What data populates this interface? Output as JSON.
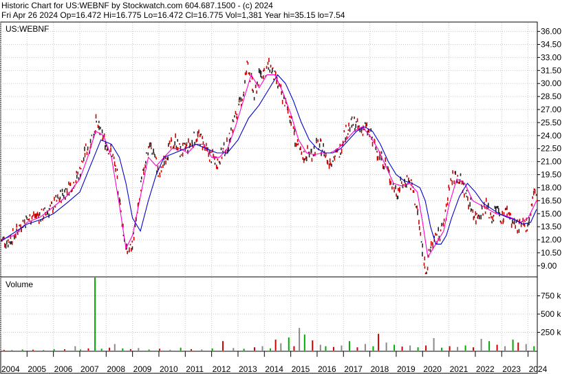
{
  "header": {
    "line1": "Historic Chart for US:WEBNF by Stockwatch.com 604.687.1500 - (c) 2024",
    "line2": "Fri Apr 26 2024   Op=16.472   Hi=16.775   Lo=16.472   Cl=16.775   Vol=1,381   Year hi=35.15   lo=7.54"
  },
  "chart_data": [
    {
      "type": "line",
      "title": "US:WEBNF",
      "ylim": [
        7.8,
        37.0
      ],
      "y_ticks": [
        "36.00",
        "34.50",
        "33.00",
        "31.50",
        "30.00",
        "28.50",
        "27.00",
        "25.50",
        "24.00",
        "22.50",
        "21.00",
        "19.50",
        "18.00",
        "16.50",
        "15.00",
        "13.50",
        "12.00",
        "10.50",
        "9.00"
      ],
      "x_ticks": [
        "2004",
        "2005",
        "2006",
        "2007",
        "2008",
        "2009",
        "2010",
        "2011",
        "2012",
        "2013",
        "2014",
        "2015",
        "2016",
        "2017",
        "2018",
        "2019",
        "2020",
        "2021",
        "2022",
        "2023",
        "2024"
      ],
      "xlim": [
        2004.0,
        2024.35
      ],
      "colors": {
        "price": "#cc0000",
        "dark": "#222222",
        "fast_ma": "#ff00cc",
        "slow_ma": "#0000cc",
        "grid": "#c8c8c8"
      },
      "series": [
        {
          "role": "price",
          "x": [
            2004.0,
            2004.25,
            2004.5,
            2004.75,
            2005.0,
            2005.25,
            2005.5,
            2005.75,
            2006.0,
            2006.25,
            2006.5,
            2006.75,
            2007.0,
            2007.2,
            2007.4,
            2007.6,
            2007.8,
            2008.0,
            2008.2,
            2008.4,
            2008.6,
            2008.75,
            2008.9,
            2009.0,
            2009.2,
            2009.4,
            2009.6,
            2009.8,
            2010.0,
            2010.2,
            2010.4,
            2010.6,
            2010.8,
            2011.0,
            2011.2,
            2011.4,
            2011.6,
            2011.8,
            2012.0,
            2012.2,
            2012.4,
            2012.6,
            2012.8,
            2013.0,
            2013.2,
            2013.35,
            2013.5,
            2013.6,
            2013.8,
            2014.0,
            2014.2,
            2014.4,
            2014.6,
            2014.8,
            2015.0,
            2015.2,
            2015.4,
            2015.6,
            2015.8,
            2016.0,
            2016.2,
            2016.4,
            2016.6,
            2016.8,
            2017.0,
            2017.2,
            2017.4,
            2017.6,
            2017.8,
            2018.0,
            2018.2,
            2018.4,
            2018.6,
            2018.8,
            2019.0,
            2019.2,
            2019.4,
            2019.6,
            2019.8,
            2020.0,
            2020.15,
            2020.3,
            2020.5,
            2020.7,
            2020.9,
            2021.0,
            2021.2,
            2021.4,
            2021.6,
            2021.8,
            2022.0,
            2022.2,
            2022.4,
            2022.6,
            2022.8,
            2023.0,
            2023.2,
            2023.4,
            2023.6,
            2023.8,
            2024.0,
            2024.2,
            2024.32
          ],
          "values": [
            12.0,
            11.8,
            12.6,
            13.8,
            14.3,
            14.8,
            14.7,
            15.2,
            16.0,
            17.0,
            17.8,
            18.6,
            20.0,
            22.3,
            23.2,
            25.5,
            24.0,
            23.0,
            22.0,
            19.0,
            14.0,
            10.5,
            11.0,
            12.0,
            15.5,
            20.0,
            23.0,
            22.0,
            19.0,
            21.5,
            22.5,
            23.5,
            22.0,
            22.5,
            23.0,
            24.0,
            23.5,
            22.0,
            21.5,
            21.0,
            22.0,
            23.0,
            25.5,
            27.0,
            29.0,
            32.5,
            30.0,
            28.5,
            31.0,
            31.5,
            32.0,
            30.5,
            29.0,
            27.5,
            26.0,
            23.0,
            21.5,
            22.0,
            22.0,
            23.0,
            22.5,
            21.0,
            21.5,
            22.0,
            24.0,
            25.0,
            25.5,
            24.5,
            25.0,
            24.0,
            22.5,
            21.5,
            20.5,
            18.5,
            17.5,
            18.5,
            19.0,
            18.0,
            15.0,
            10.0,
            8.5,
            11.5,
            12.0,
            13.0,
            15.5,
            18.5,
            19.5,
            19.0,
            17.5,
            16.0,
            14.5,
            15.5,
            16.0,
            14.5,
            15.5,
            14.5,
            15.5,
            14.0,
            13.5,
            13.5,
            14.0,
            17.5,
            16.8
          ]
        },
        {
          "role": "fast_ma",
          "x": [
            2004.0,
            2004.5,
            2005.0,
            2005.5,
            2006.0,
            2006.5,
            2007.0,
            2007.3,
            2007.6,
            2007.9,
            2008.2,
            2008.5,
            2008.75,
            2009.0,
            2009.3,
            2009.6,
            2009.9,
            2010.2,
            2010.5,
            2010.8,
            2011.1,
            2011.4,
            2011.7,
            2012.0,
            2012.3,
            2012.6,
            2012.9,
            2013.2,
            2013.5,
            2013.8,
            2014.1,
            2014.4,
            2014.7,
            2015.0,
            2015.3,
            2015.6,
            2015.9,
            2016.2,
            2016.5,
            2016.8,
            2017.1,
            2017.4,
            2017.7,
            2018.0,
            2018.3,
            2018.6,
            2018.9,
            2019.2,
            2019.5,
            2019.8,
            2020.0,
            2020.2,
            2020.4,
            2020.6,
            2020.8,
            2021.0,
            2021.3,
            2021.6,
            2021.9,
            2022.2,
            2022.5,
            2022.8,
            2023.1,
            2023.4,
            2023.7,
            2024.0,
            2024.32
          ],
          "values": [
            12.0,
            12.5,
            14.0,
            14.6,
            15.8,
            17.0,
            19.0,
            21.5,
            24.5,
            24.0,
            21.5,
            16.0,
            11.0,
            12.5,
            17.0,
            21.5,
            20.5,
            21.5,
            22.5,
            22.5,
            22.0,
            23.0,
            23.0,
            21.5,
            21.5,
            22.5,
            25.0,
            28.0,
            31.0,
            29.5,
            31.0,
            31.0,
            29.0,
            26.5,
            23.5,
            22.0,
            21.8,
            22.0,
            22.0,
            22.5,
            23.5,
            24.5,
            25.0,
            24.0,
            22.5,
            20.5,
            18.5,
            18.2,
            18.5,
            17.5,
            14.0,
            10.0,
            11.0,
            12.0,
            13.0,
            16.0,
            19.0,
            18.5,
            16.5,
            16.0,
            15.5,
            15.0,
            14.8,
            14.5,
            14.0,
            14.5,
            16.5
          ]
        },
        {
          "role": "slow_ma",
          "x": [
            2004.0,
            2004.5,
            2005.0,
            2005.5,
            2006.0,
            2006.5,
            2007.0,
            2007.4,
            2007.8,
            2008.2,
            2008.5,
            2008.75,
            2009.0,
            2009.3,
            2009.6,
            2009.9,
            2010.2,
            2010.6,
            2011.0,
            2011.4,
            2011.8,
            2012.2,
            2012.6,
            2013.0,
            2013.4,
            2013.8,
            2014.2,
            2014.5,
            2014.8,
            2015.1,
            2015.4,
            2015.7,
            2016.0,
            2016.3,
            2016.6,
            2016.9,
            2017.2,
            2017.5,
            2017.8,
            2018.1,
            2018.4,
            2018.7,
            2019.0,
            2019.3,
            2019.6,
            2019.9,
            2020.1,
            2020.3,
            2020.5,
            2020.7,
            2020.9,
            2021.1,
            2021.4,
            2021.7,
            2022.0,
            2022.3,
            2022.6,
            2022.9,
            2023.2,
            2023.5,
            2023.8,
            2024.1,
            2024.32
          ],
          "values": [
            11.8,
            12.8,
            13.8,
            14.3,
            15.0,
            16.2,
            17.5,
            20.5,
            23.5,
            23.0,
            21.5,
            18.5,
            14.5,
            13.0,
            16.5,
            19.5,
            21.5,
            22.0,
            22.5,
            23.0,
            22.5,
            22.0,
            22.0,
            23.5,
            26.0,
            27.5,
            29.5,
            31.0,
            30.0,
            28.0,
            25.5,
            23.5,
            22.5,
            22.0,
            22.0,
            22.5,
            23.5,
            24.5,
            25.0,
            24.5,
            23.0,
            21.0,
            19.5,
            18.8,
            18.5,
            18.0,
            16.5,
            13.5,
            11.5,
            11.5,
            12.5,
            14.5,
            17.0,
            18.5,
            17.5,
            16.2,
            15.6,
            15.0,
            14.6,
            14.3,
            13.8,
            14.0,
            15.5
          ]
        }
      ]
    },
    {
      "type": "bar",
      "title": "Volume",
      "ylim": [
        0,
        1000
      ],
      "y_ticks": [
        "750 k",
        "500 k",
        "250 k"
      ],
      "y_tick_values": [
        750,
        500,
        250
      ],
      "x": [
        2004.1,
        2004.4,
        2004.8,
        2005.2,
        2005.6,
        2006.0,
        2006.4,
        2006.8,
        2007.0,
        2007.3,
        2007.55,
        2007.8,
        2008.1,
        2008.3,
        2008.6,
        2008.9,
        2009.2,
        2009.6,
        2010.0,
        2010.4,
        2010.8,
        2011.2,
        2011.6,
        2012.0,
        2012.4,
        2012.8,
        2013.2,
        2013.6,
        2013.9,
        2014.2,
        2014.4,
        2014.6,
        2014.9,
        2015.1,
        2015.3,
        2015.5,
        2015.8,
        2016.1,
        2016.3,
        2016.6,
        2016.9,
        2017.2,
        2017.5,
        2017.8,
        2018.1,
        2018.3,
        2018.6,
        2018.9,
        2019.2,
        2019.5,
        2019.8,
        2020.1,
        2020.4,
        2020.7,
        2021.0,
        2021.3,
        2021.6,
        2021.9,
        2022.2,
        2022.5,
        2022.8,
        2023.1,
        2023.4,
        2023.6,
        2023.9,
        2024.2
      ],
      "values": [
        10,
        8,
        15,
        12,
        10,
        20,
        18,
        60,
        15,
        30,
        1000,
        25,
        40,
        90,
        30,
        20,
        35,
        15,
        25,
        12,
        40,
        20,
        15,
        30,
        130,
        35,
        25,
        45,
        60,
        30,
        150,
        100,
        180,
        60,
        310,
        220,
        140,
        80,
        60,
        50,
        70,
        130,
        45,
        90,
        60,
        230,
        110,
        80,
        55,
        70,
        45,
        70,
        170,
        40,
        60,
        50,
        70,
        45,
        160,
        130,
        80,
        60,
        150,
        110,
        90,
        60
      ]
    }
  ]
}
